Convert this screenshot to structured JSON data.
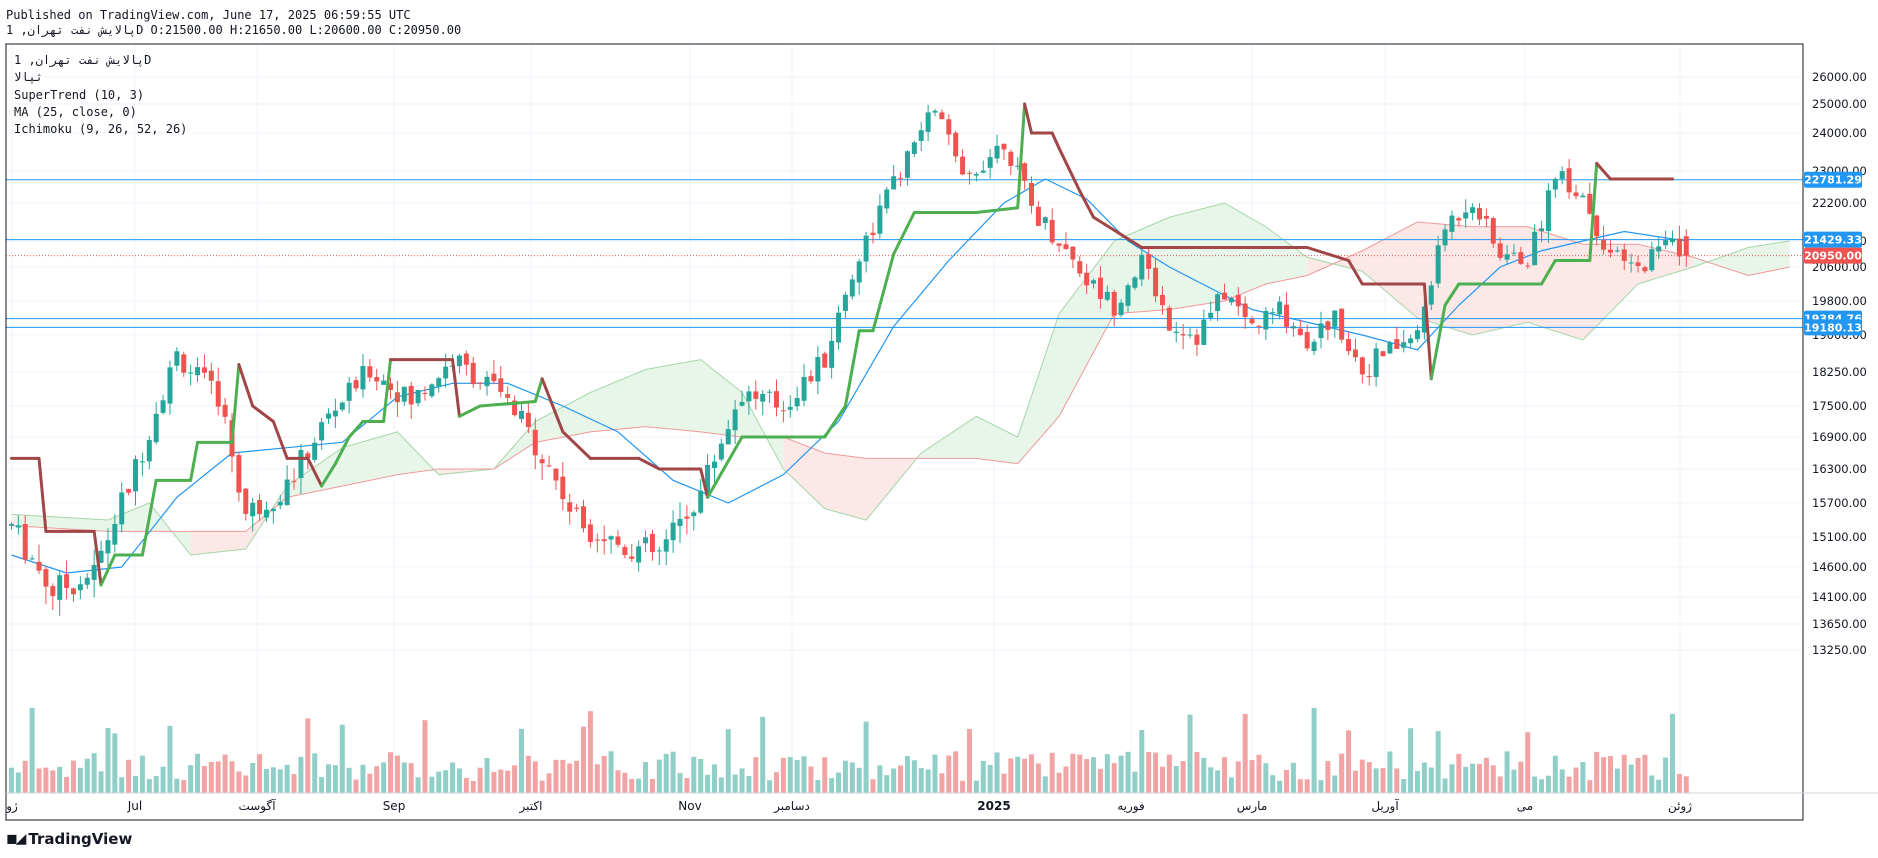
{
  "header": {
    "published": "Published on TradingView.com, June 17, 2025 06:59:55 UTC",
    "ohlc_line": "پالایش نفت تهران, 1D O:21500.00 H:21650.00 L:20600.00 C:20950.00"
  },
  "legend": {
    "symbol": "پالایش نفت تهران, 1D",
    "name": "ثپالا",
    "indicators": [
      "SuperTrend (10, 3)",
      "MA (25, close, 0)",
      "Ichimoku (9, 26, 52, 26)"
    ]
  },
  "footer": {
    "brand": "TradingView"
  },
  "colors": {
    "up": "#26a69a",
    "down": "#ef5350",
    "vol_up": "#8fcfc8",
    "vol_down": "#f2a4a4",
    "supertrend_up": "#4caf50",
    "supertrend_down": "#a04646",
    "ma": "#2196f3",
    "hline": "#2196f3",
    "cloud_bull": "#e8f5e9",
    "cloud_bear": "#fde8e8",
    "last_price": "#ef5350"
  },
  "chart_data": {
    "type": "candlestick",
    "y_axis": {
      "range": [
        13000,
        26500
      ],
      "ticks": [
        "26000.00",
        "25000.00",
        "24000.00",
        "23000.00",
        "22200.00",
        "21400.00",
        "20600.00",
        "19800.00",
        "19000.00",
        "18250.00",
        "17500.00",
        "16900.00",
        "16300.00",
        "15700.00",
        "15100.00",
        "14600.00",
        "14100.00",
        "13650.00",
        "13250.00"
      ]
    },
    "x_axis": {
      "labels": [
        "ژو",
        "Jul",
        "آگوست",
        "Sep",
        "اکتبر",
        "Nov",
        "دسامبر",
        "2025",
        "فوریه",
        "مارس",
        "آوریل",
        "می",
        "ژوئن"
      ]
    },
    "price_lines": [
      {
        "value": 22781.29,
        "label": "22781.29"
      },
      {
        "value": 21429.33,
        "label": "21429.33"
      },
      {
        "value": 19384.76,
        "label": "19384.76"
      },
      {
        "value": 19180.13,
        "label": "19180.13"
      }
    ],
    "last_price": {
      "value": 20950.0,
      "label": "20950.00"
    },
    "last_ohlc": {
      "open": 21500,
      "high": 21650,
      "low": 20600,
      "close": 20950
    },
    "close_path": [
      {
        "i": 0,
        "v": 15300
      },
      {
        "i": 6,
        "v": 14200
      },
      {
        "i": 12,
        "v": 14500
      },
      {
        "i": 18,
        "v": 16300
      },
      {
        "i": 24,
        "v": 18600
      },
      {
        "i": 30,
        "v": 17700
      },
      {
        "i": 34,
        "v": 15500
      },
      {
        "i": 40,
        "v": 16000
      },
      {
        "i": 46,
        "v": 17300
      },
      {
        "i": 52,
        "v": 18300
      },
      {
        "i": 58,
        "v": 17600
      },
      {
        "i": 64,
        "v": 18500
      },
      {
        "i": 70,
        "v": 17900
      },
      {
        "i": 76,
        "v": 16800
      },
      {
        "i": 82,
        "v": 15400
      },
      {
        "i": 88,
        "v": 15000
      },
      {
        "i": 94,
        "v": 14800
      },
      {
        "i": 100,
        "v": 15900
      },
      {
        "i": 106,
        "v": 17800
      },
      {
        "i": 112,
        "v": 17500
      },
      {
        "i": 118,
        "v": 18500
      },
      {
        "i": 124,
        "v": 21400
      },
      {
        "i": 130,
        "v": 23300
      },
      {
        "i": 134,
        "v": 24900
      },
      {
        "i": 138,
        "v": 22700
      },
      {
        "i": 144,
        "v": 23800
      },
      {
        "i": 148,
        "v": 22100
      },
      {
        "i": 152,
        "v": 21400
      },
      {
        "i": 156,
        "v": 20300
      },
      {
        "i": 160,
        "v": 19700
      },
      {
        "i": 164,
        "v": 20800
      },
      {
        "i": 168,
        "v": 19300
      },
      {
        "i": 172,
        "v": 19000
      },
      {
        "i": 176,
        "v": 20000
      },
      {
        "i": 180,
        "v": 19200
      },
      {
        "i": 184,
        "v": 19600
      },
      {
        "i": 188,
        "v": 18900
      },
      {
        "i": 192,
        "v": 19400
      },
      {
        "i": 196,
        "v": 18300
      },
      {
        "i": 200,
        "v": 18700
      },
      {
        "i": 204,
        "v": 19000
      },
      {
        "i": 208,
        "v": 21700
      },
      {
        "i": 212,
        "v": 22300
      },
      {
        "i": 216,
        "v": 21000
      },
      {
        "i": 220,
        "v": 20800
      },
      {
        "i": 224,
        "v": 23000
      },
      {
        "i": 228,
        "v": 22400
      },
      {
        "i": 232,
        "v": 21000
      },
      {
        "i": 236,
        "v": 20500
      },
      {
        "i": 240,
        "v": 21500
      },
      {
        "i": 243,
        "v": 20950
      }
    ],
    "supertrend_path": [
      {
        "i": 0,
        "v": 16500,
        "t": "down"
      },
      {
        "i": 4,
        "v": 16500,
        "t": "down"
      },
      {
        "i": 5,
        "v": 15200,
        "t": "down"
      },
      {
        "i": 12,
        "v": 15200,
        "t": "down"
      },
      {
        "i": 13,
        "v": 14300,
        "t": "up"
      },
      {
        "i": 15,
        "v": 14800,
        "t": "up"
      },
      {
        "i": 19,
        "v": 14800,
        "t": "up"
      },
      {
        "i": 21,
        "v": 16100,
        "t": "up"
      },
      {
        "i": 26,
        "v": 16100,
        "t": "up"
      },
      {
        "i": 27,
        "v": 16800,
        "t": "up"
      },
      {
        "i": 32,
        "v": 16800,
        "t": "up"
      },
      {
        "i": 33,
        "v": 18400,
        "t": "down"
      },
      {
        "i": 35,
        "v": 17500,
        "t": "down"
      },
      {
        "i": 38,
        "v": 17200,
        "t": "down"
      },
      {
        "i": 40,
        "v": 16500,
        "t": "down"
      },
      {
        "i": 43,
        "v": 16500,
        "t": "down"
      },
      {
        "i": 45,
        "v": 16000,
        "t": "up"
      },
      {
        "i": 47,
        "v": 16400,
        "t": "up"
      },
      {
        "i": 49,
        "v": 16900,
        "t": "up"
      },
      {
        "i": 51,
        "v": 17200,
        "t": "up"
      },
      {
        "i": 54,
        "v": 17200,
        "t": "up"
      },
      {
        "i": 55,
        "v": 18500,
        "t": "down"
      },
      {
        "i": 64,
        "v": 18500,
        "t": "down"
      },
      {
        "i": 65,
        "v": 17300,
        "t": "up"
      },
      {
        "i": 68,
        "v": 17500,
        "t": "up"
      },
      {
        "i": 76,
        "v": 17600,
        "t": "up"
      },
      {
        "i": 77,
        "v": 18100,
        "t": "down"
      },
      {
        "i": 80,
        "v": 17000,
        "t": "down"
      },
      {
        "i": 84,
        "v": 16500,
        "t": "down"
      },
      {
        "i": 91,
        "v": 16500,
        "t": "down"
      },
      {
        "i": 94,
        "v": 16300,
        "t": "down"
      },
      {
        "i": 100,
        "v": 16300,
        "t": "down"
      },
      {
        "i": 101,
        "v": 15800,
        "t": "up"
      },
      {
        "i": 106,
        "v": 16900,
        "t": "up"
      },
      {
        "i": 118,
        "v": 16900,
        "t": "up"
      },
      {
        "i": 121,
        "v": 17500,
        "t": "up"
      },
      {
        "i": 123,
        "v": 19100,
        "t": "up"
      },
      {
        "i": 125,
        "v": 19100,
        "t": "up"
      },
      {
        "i": 128,
        "v": 21000,
        "t": "up"
      },
      {
        "i": 131,
        "v": 22000,
        "t": "up"
      },
      {
        "i": 140,
        "v": 22000,
        "t": "up"
      },
      {
        "i": 146,
        "v": 22100,
        "t": "up"
      },
      {
        "i": 147,
        "v": 25000,
        "t": "down"
      },
      {
        "i": 148,
        "v": 24000,
        "t": "down"
      },
      {
        "i": 151,
        "v": 24000,
        "t": "down"
      },
      {
        "i": 152,
        "v": 23600,
        "t": "down"
      },
      {
        "i": 155,
        "v": 22500,
        "t": "down"
      },
      {
        "i": 157,
        "v": 21900,
        "t": "down"
      },
      {
        "i": 164,
        "v": 21200,
        "t": "down"
      },
      {
        "i": 188,
        "v": 21200,
        "t": "down"
      },
      {
        "i": 194,
        "v": 20800,
        "t": "down"
      },
      {
        "i": 196,
        "v": 20200,
        "t": "down"
      },
      {
        "i": 205,
        "v": 20200,
        "t": "down"
      },
      {
        "i": 206,
        "v": 18100,
        "t": "up"
      },
      {
        "i": 208,
        "v": 19700,
        "t": "up"
      },
      {
        "i": 210,
        "v": 20200,
        "t": "up"
      },
      {
        "i": 222,
        "v": 20200,
        "t": "up"
      },
      {
        "i": 224,
        "v": 20800,
        "t": "up"
      },
      {
        "i": 229,
        "v": 20800,
        "t": "up"
      },
      {
        "i": 230,
        "v": 23200,
        "t": "down"
      },
      {
        "i": 232,
        "v": 22800,
        "t": "down"
      },
      {
        "i": 241,
        "v": 22800,
        "t": "down"
      }
    ],
    "ma_path": [
      {
        "i": 0,
        "v": 14800
      },
      {
        "i": 8,
        "v": 14500
      },
      {
        "i": 16,
        "v": 14600
      },
      {
        "i": 24,
        "v": 15800
      },
      {
        "i": 32,
        "v": 16600
      },
      {
        "i": 40,
        "v": 16700
      },
      {
        "i": 48,
        "v": 16800
      },
      {
        "i": 56,
        "v": 17700
      },
      {
        "i": 64,
        "v": 18000
      },
      {
        "i": 72,
        "v": 18000
      },
      {
        "i": 80,
        "v": 17500
      },
      {
        "i": 88,
        "v": 17000
      },
      {
        "i": 96,
        "v": 16100
      },
      {
        "i": 104,
        "v": 15700
      },
      {
        "i": 112,
        "v": 16200
      },
      {
        "i": 120,
        "v": 17200
      },
      {
        "i": 128,
        "v": 19200
      },
      {
        "i": 136,
        "v": 20800
      },
      {
        "i": 144,
        "v": 22200
      },
      {
        "i": 150,
        "v": 22800
      },
      {
        "i": 156,
        "v": 22300
      },
      {
        "i": 162,
        "v": 21400
      },
      {
        "i": 168,
        "v": 20600
      },
      {
        "i": 174,
        "v": 20100
      },
      {
        "i": 180,
        "v": 19600
      },
      {
        "i": 188,
        "v": 19300
      },
      {
        "i": 196,
        "v": 19000
      },
      {
        "i": 204,
        "v": 18700
      },
      {
        "i": 210,
        "v": 19700
      },
      {
        "i": 216,
        "v": 20600
      },
      {
        "i": 222,
        "v": 21100
      },
      {
        "i": 228,
        "v": 21400
      },
      {
        "i": 234,
        "v": 21600
      },
      {
        "i": 243,
        "v": 21400
      }
    ],
    "cloud": [
      {
        "i": 0,
        "a": 15500,
        "b": 15300
      },
      {
        "i": 14,
        "a": 15400,
        "b": 15200
      },
      {
        "i": 20,
        "a": 15700,
        "b": 15200
      },
      {
        "i": 26,
        "a": 14800,
        "b": 15200
      },
      {
        "i": 34,
        "a": 14900,
        "b": 15200
      },
      {
        "i": 40,
        "a": 16000,
        "b": 15800
      },
      {
        "i": 48,
        "a": 16700,
        "b": 16000
      },
      {
        "i": 56,
        "a": 17000,
        "b": 16200
      },
      {
        "i": 62,
        "a": 16200,
        "b": 16300
      },
      {
        "i": 70,
        "a": 16300,
        "b": 16300
      },
      {
        "i": 76,
        "a": 17200,
        "b": 16800
      },
      {
        "i": 84,
        "a": 17800,
        "b": 17000
      },
      {
        "i": 92,
        "a": 18300,
        "b": 17100
      },
      {
        "i": 100,
        "a": 18500,
        "b": 17000
      },
      {
        "i": 106,
        "a": 17800,
        "b": 16900
      },
      {
        "i": 112,
        "a": 16300,
        "b": 16900
      },
      {
        "i": 118,
        "a": 15600,
        "b": 16600
      },
      {
        "i": 124,
        "a": 15400,
        "b": 16500
      },
      {
        "i": 132,
        "a": 16600,
        "b": 16500
      },
      {
        "i": 140,
        "a": 17300,
        "b": 16500
      },
      {
        "i": 146,
        "a": 16900,
        "b": 16400
      },
      {
        "i": 152,
        "a": 19500,
        "b": 17300
      },
      {
        "i": 160,
        "a": 21400,
        "b": 19500
      },
      {
        "i": 168,
        "a": 21900,
        "b": 19600
      },
      {
        "i": 176,
        "a": 22200,
        "b": 19800
      },
      {
        "i": 182,
        "a": 21700,
        "b": 20200
      },
      {
        "i": 188,
        "a": 20900,
        "b": 20400
      },
      {
        "i": 196,
        "a": 20500,
        "b": 21100
      },
      {
        "i": 204,
        "a": 19400,
        "b": 21800
      },
      {
        "i": 212,
        "a": 19000,
        "b": 21700
      },
      {
        "i": 220,
        "a": 19300,
        "b": 21700
      },
      {
        "i": 228,
        "a": 18900,
        "b": 21300
      },
      {
        "i": 236,
        "a": 20200,
        "b": 21300
      },
      {
        "i": 244,
        "a": 20600,
        "b": 20900
      },
      {
        "i": 252,
        "a": 21200,
        "b": 20400
      },
      {
        "i": 258,
        "a": 21400,
        "b": 20600
      }
    ],
    "volume_range": [
      0,
      1000
    ]
  }
}
